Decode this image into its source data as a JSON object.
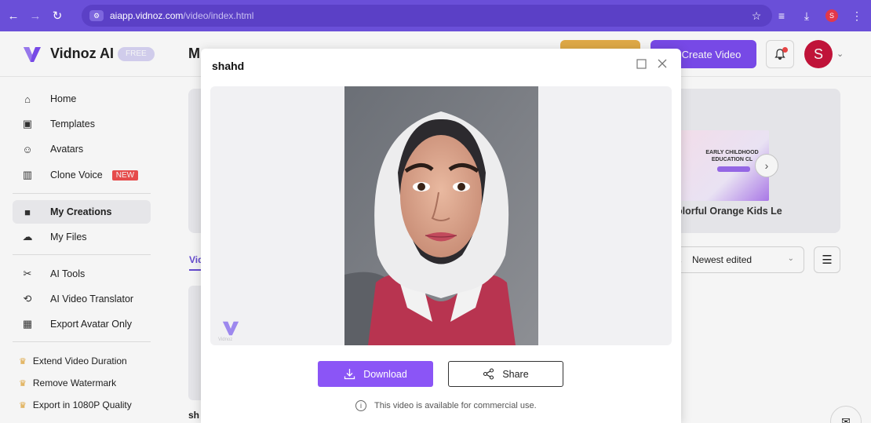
{
  "browser": {
    "url_host": "aiapp.vidnoz.com",
    "url_path": "/video/index.html",
    "profile_initial": "S"
  },
  "header": {
    "brand": "Vidnoz AI",
    "plan_badge": "FREE",
    "page_title_fragment": "M",
    "create_button": "Create Video",
    "avatar_initial": "S"
  },
  "sidebar": {
    "items": [
      {
        "label": "Home",
        "icon": "home-icon"
      },
      {
        "label": "Templates",
        "icon": "templates-icon"
      },
      {
        "label": "Avatars",
        "icon": "avatar-icon"
      },
      {
        "label": "Clone Voice",
        "icon": "voice-icon",
        "badge": "NEW"
      },
      {
        "label": "My Creations",
        "icon": "creations-icon",
        "active": true
      },
      {
        "label": "My Files",
        "icon": "upload-cloud-icon"
      },
      {
        "label": "AI Tools",
        "icon": "tools-icon"
      },
      {
        "label": "AI Video Translator",
        "icon": "translate-icon"
      },
      {
        "label": "Export Avatar Only",
        "icon": "export-avatar-icon"
      }
    ],
    "perks": [
      "Extend Video Duration",
      "Remove Watermark",
      "Export in 1080P Quality"
    ]
  },
  "main": {
    "template_caption": "olorful Orange Kids Le",
    "template_thumb_text": "EARLY CHILDHOOD EDUCATION CL",
    "tab_fragment": "Vid",
    "sort_value": "Newest edited",
    "card_label_fragment": "sh"
  },
  "modal": {
    "title": "shahd",
    "watermark_text": "Vidnoz",
    "download_label": "Download",
    "share_label": "Share",
    "notice": "This video is available for commercial use."
  },
  "colors": {
    "brand_purple": "#7c4df0",
    "download_purple": "#8b55f6",
    "browser_bar": "#6a4fd8",
    "new_badge": "#f04f4f",
    "avatar_red": "#c8143c"
  }
}
